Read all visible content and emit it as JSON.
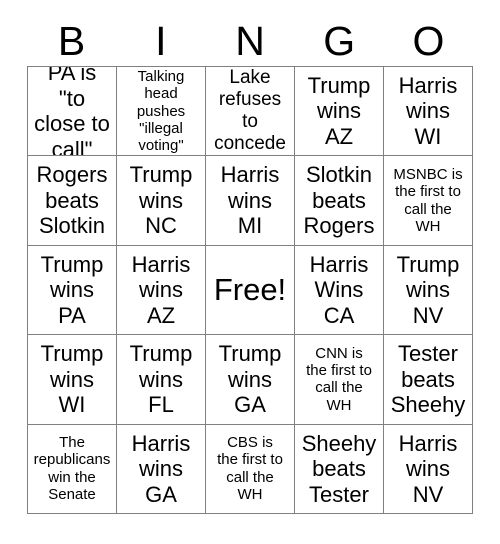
{
  "card": {
    "title": "BINGO",
    "header_letters": [
      "B",
      "I",
      "N",
      "G",
      "O"
    ],
    "grid_size": "5x5",
    "border_color": "#808080",
    "text_color": "#000000",
    "background_color": "#ffffff",
    "cells": [
      {
        "text": "PA is \"to\nclose to\ncall\"",
        "size": "lg",
        "free": false
      },
      {
        "text": "Talking head\npushes\n\"illegal\nvoting\"",
        "size": "sm",
        "free": false
      },
      {
        "text": "Lake\nrefuses to\nconcede",
        "size": "md",
        "free": false
      },
      {
        "text": "Trump\nwins\nAZ",
        "size": "lg",
        "free": false
      },
      {
        "text": "Harris\nwins\nWI",
        "size": "lg",
        "free": false
      },
      {
        "text": "Rogers\nbeats\nSlotkin",
        "size": "lg",
        "free": false
      },
      {
        "text": "Trump\nwins\nNC",
        "size": "lg",
        "free": false
      },
      {
        "text": "Harris\nwins\nMI",
        "size": "lg",
        "free": false
      },
      {
        "text": "Slotkin\nbeats\nRogers",
        "size": "lg",
        "free": false
      },
      {
        "text": "MSNBC is\nthe first to\ncall the\nWH",
        "size": "sm",
        "free": false
      },
      {
        "text": "Trump\nwins\nPA",
        "size": "lg",
        "free": false
      },
      {
        "text": "Harris\nwins\nAZ",
        "size": "lg",
        "free": false
      },
      {
        "text": "Free!",
        "size": "xl",
        "free": true
      },
      {
        "text": "Harris\nWins\nCA",
        "size": "lg",
        "free": false
      },
      {
        "text": "Trump\nwins\nNV",
        "size": "lg",
        "free": false
      },
      {
        "text": "Trump\nwins\nWI",
        "size": "lg",
        "free": false
      },
      {
        "text": "Trump\nwins\nFL",
        "size": "lg",
        "free": false
      },
      {
        "text": "Trump\nwins\nGA",
        "size": "lg",
        "free": false
      },
      {
        "text": "CNN is\nthe first to\ncall the\nWH",
        "size": "sm",
        "free": false
      },
      {
        "text": "Tester\nbeats\nSheehy",
        "size": "lg",
        "free": false
      },
      {
        "text": "The\nrepublicans\nwin the\nSenate",
        "size": "sm",
        "free": false
      },
      {
        "text": "Harris\nwins\nGA",
        "size": "lg",
        "free": false
      },
      {
        "text": "CBS is\nthe first to\ncall the\nWH",
        "size": "sm",
        "free": false
      },
      {
        "text": "Sheehy\nbeats\nTester",
        "size": "lg",
        "free": false
      },
      {
        "text": "Harris\nwins\nNV",
        "size": "lg",
        "free": false
      }
    ]
  }
}
